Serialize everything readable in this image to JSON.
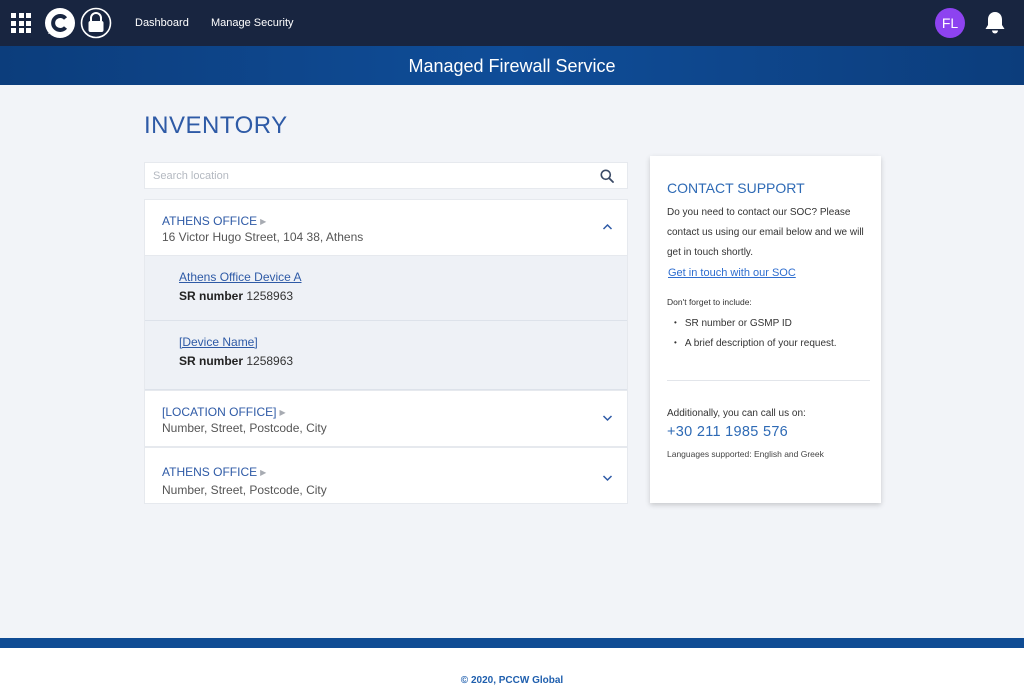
{
  "topbar": {
    "nav": [
      "Dashboard",
      "Manage Security"
    ],
    "avatar_initials": "FL",
    "icons": [
      "apps-grid-icon",
      "brand-c-logo",
      "lock-logo",
      "bell-icon"
    ]
  },
  "banner": {
    "title": "Managed Firewall Service"
  },
  "page": {
    "title": "INVENTORY"
  },
  "search": {
    "placeholder": "Search location",
    "value": ""
  },
  "locations": [
    {
      "name": "ATHENS OFFICE",
      "address": "16 Victor Hugo Street, 104 38, Athens",
      "expanded": true,
      "devices": [
        {
          "name": "Athens Office Device A",
          "sr_label": "SR number",
          "sr_value": "1258963"
        },
        {
          "name": "[Device Name]",
          "sr_label": "SR number",
          "sr_value": "1258963"
        }
      ]
    },
    {
      "name": "[LOCATION OFFICE]",
      "address": "Number, Street, Postcode, City",
      "expanded": false
    },
    {
      "name": "ATHENS OFFICE",
      "address": "Number, Street, Postcode, City",
      "expanded": false
    }
  ],
  "support": {
    "title": "CONTACT SUPPORT",
    "body": "Do you need to contact our SOC? Please contact us using our email below and we will get in touch shortly.",
    "link": "Get in touch with our SOC",
    "reminder": "Don't forget to include:",
    "items": [
      "SR number or GSMP ID",
      "A brief description of your request."
    ],
    "call_text": "Additionally, you can call us on:",
    "phone": "+30 211 1985 576",
    "languages": "Languages supported: English and Greek"
  },
  "footer": {
    "text": "© 2020, PCCW Global"
  },
  "colors": {
    "topbar": "#182540",
    "banner": "#0f4d98",
    "accent": "#2e5aa6",
    "avatar": "#8d43f0",
    "background": "#f2f4f8"
  }
}
